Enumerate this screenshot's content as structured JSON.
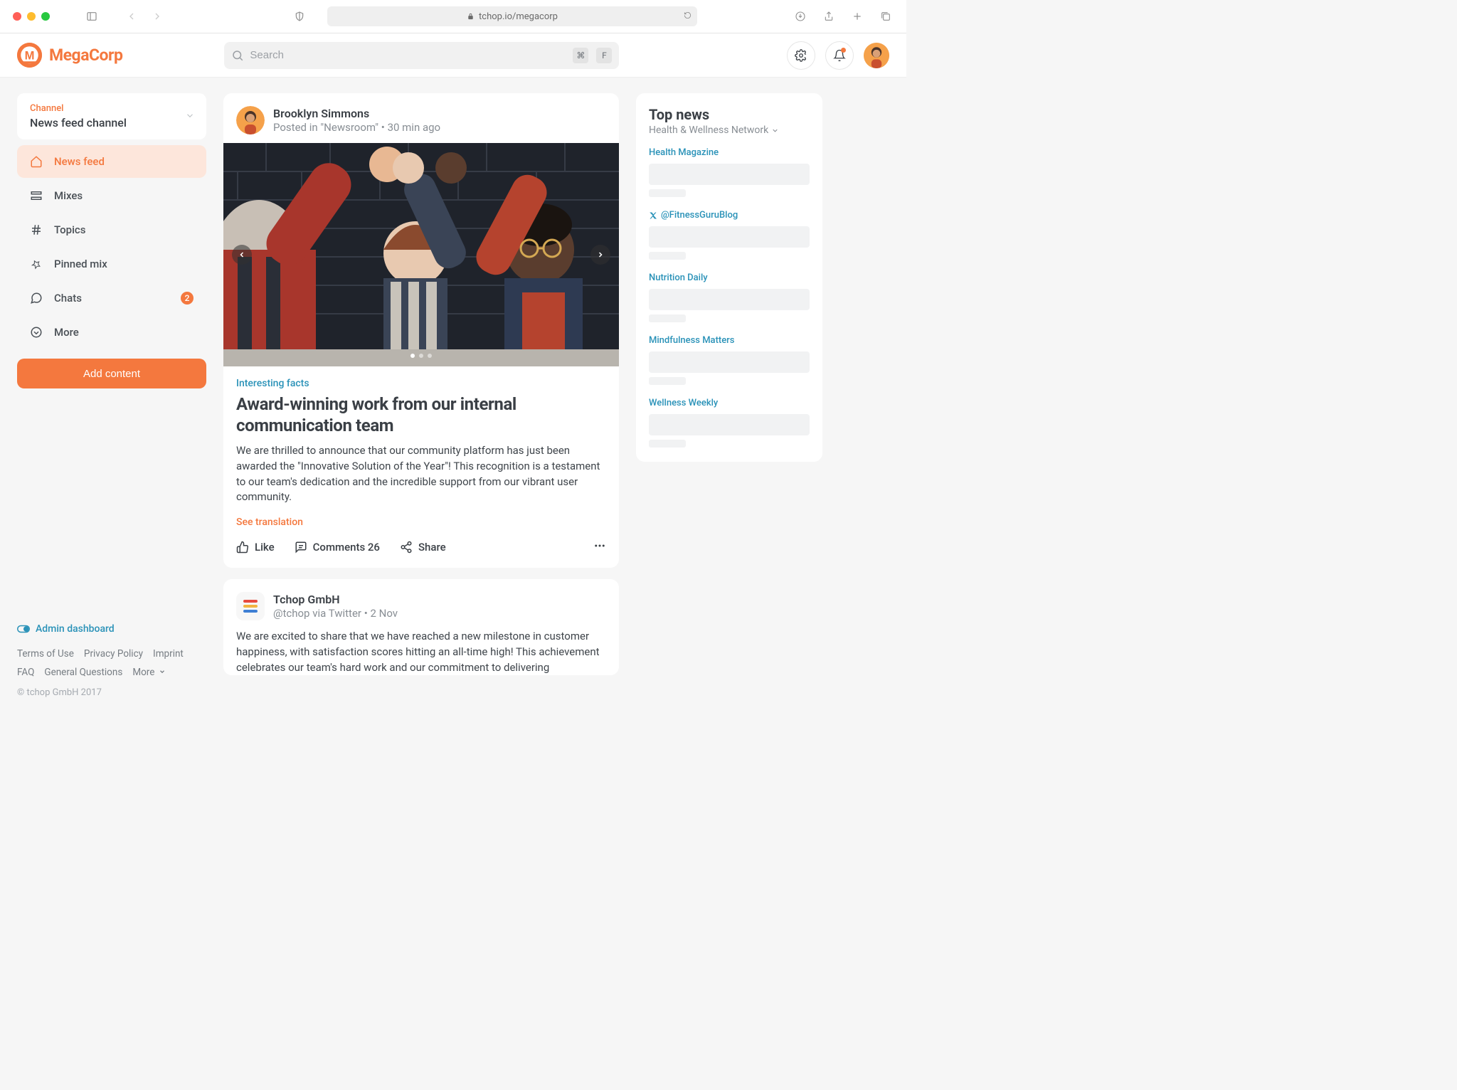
{
  "browser": {
    "url": "tchop.io/megacorp"
  },
  "brand": {
    "name": "MegaCorp"
  },
  "search": {
    "placeholder": "Search",
    "kbd1": "⌘",
    "kbd2": "F"
  },
  "sidebar": {
    "channel_label": "Channel",
    "channel_name": "News feed channel",
    "nav": [
      {
        "label": "News feed"
      },
      {
        "label": "Mixes"
      },
      {
        "label": "Topics"
      },
      {
        "label": "Pinned mix"
      },
      {
        "label": "Chats",
        "badge": "2"
      },
      {
        "label": "More"
      }
    ],
    "add_content": "Add content",
    "admin_link": "Admin dashboard",
    "footer": {
      "terms": "Terms of Use",
      "privacy": "Privacy Policy",
      "imprint": "Imprint",
      "faq": "FAQ",
      "general": "General Questions",
      "more": "More"
    },
    "copyright": "© tchop GmbH 2017"
  },
  "posts": [
    {
      "author": "Brooklyn Simmons",
      "meta": "Posted in \"Newsroom\" • 30 min ago",
      "tag": "Interesting facts",
      "title": "Award-winning work from our internal communication team",
      "body": "We are thrilled to announce that our community platform has just been awarded the \"Innovative Solution of the Year\"! This recognition is a testament to our team's dedication and the incredible support from our vibrant user community.",
      "translate": "See translation",
      "like": "Like",
      "comments": "Comments 26",
      "share": "Share"
    },
    {
      "author": "Tchop GmbH",
      "meta": "@tchop via Twitter • 2 Nov",
      "body": "We are excited to share that we have reached a new milestone in customer happiness, with satisfaction scores hitting an all-time high! This achievement celebrates our team's hard work and our commitment to delivering"
    }
  ],
  "news": {
    "title": "Top news",
    "subtitle": "Health & Wellness Network",
    "items": [
      {
        "source": "Health Magazine"
      },
      {
        "source": "@FitnessGuruBlog",
        "twitter": true
      },
      {
        "source": "Nutrition Daily"
      },
      {
        "source": "Mindfulness Matters"
      },
      {
        "source": "Wellness Weekly"
      }
    ]
  }
}
